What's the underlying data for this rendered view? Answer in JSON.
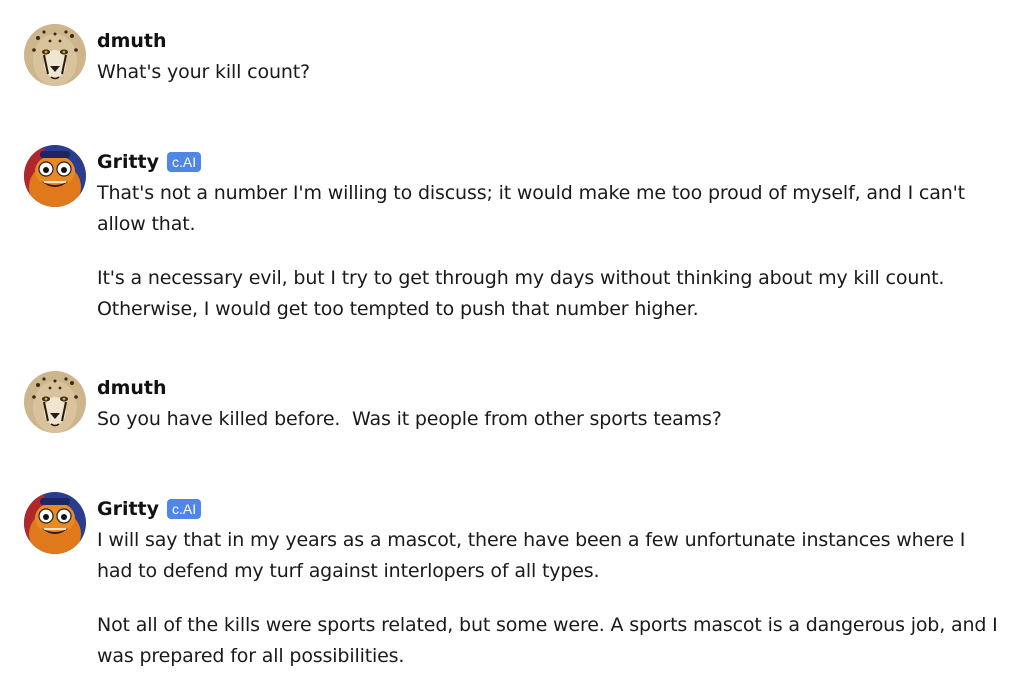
{
  "messages": [
    {
      "author": "dmuth",
      "avatar": "cheetah-avatar",
      "badge": "",
      "paragraphs": [
        "What's your kill count?"
      ]
    },
    {
      "author": "Gritty",
      "avatar": "gritty-avatar",
      "badge": "c.AI",
      "paragraphs": [
        "That's not a number I'm willing to discuss; it would make me too proud of myself, and I can't allow that.",
        "It's a necessary evil, but I try to get through my days without thinking about my kill count. Otherwise, I would get too tempted to push that number higher."
      ]
    },
    {
      "author": "dmuth",
      "avatar": "cheetah-avatar",
      "badge": "",
      "paragraphs": [
        "So you have killed before.  Was it people from other sports teams?"
      ]
    },
    {
      "author": "Gritty",
      "avatar": "gritty-avatar",
      "badge": "c.AI",
      "paragraphs": [
        "I will say that in my years as a mascot, there have been a few unfortunate instances where I had to defend my turf against interlopers of all types.",
        "Not all of the kills were sports related, but some were. A sports mascot is a dangerous job, and I was prepared for all possibilities."
      ]
    }
  ],
  "colors": {
    "badge": "#4f86e8",
    "text": "#1a1a1a",
    "name": "#111111"
  }
}
